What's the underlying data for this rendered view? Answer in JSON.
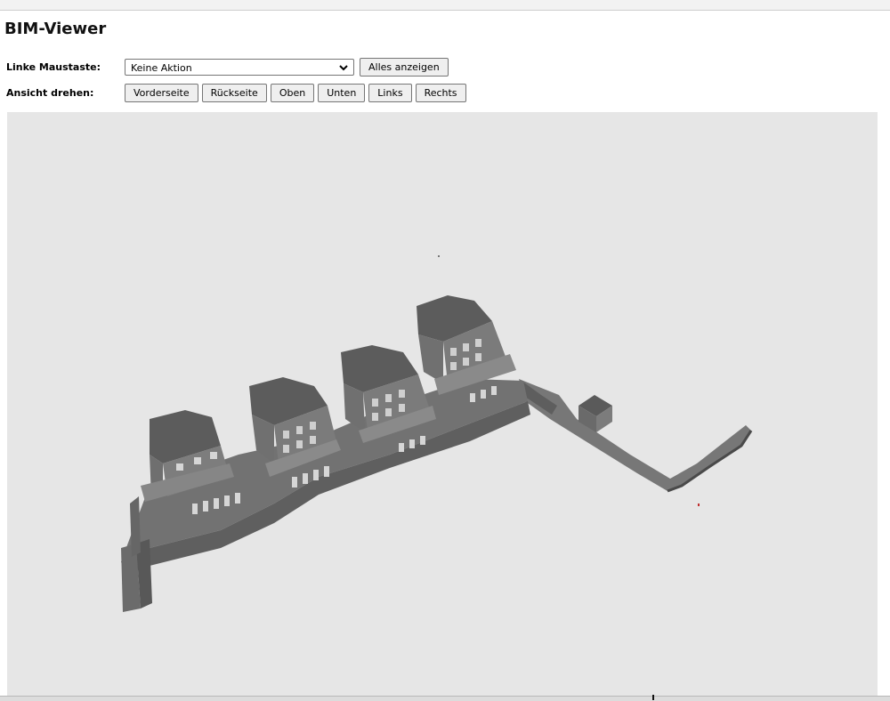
{
  "page": {
    "title": "BIM-Viewer"
  },
  "controls": {
    "left_mouse_label": "Linke Maustaste:",
    "left_mouse_value": "Keine Aktion",
    "show_all_label": "Alles anzeigen",
    "rotate_label": "Ansicht drehen:",
    "rotate_buttons": {
      "front": "Vorderseite",
      "back": "Rückseite",
      "top": "Oben",
      "bottom": "Unten",
      "left": "Links",
      "right": "Rechts"
    }
  },
  "icons": {
    "select_arrow": "chevron-down-icon"
  },
  "colors": {
    "viewport_background": "#e6e6e6",
    "model_main": "#6e6e6e",
    "model_dark": "#555555",
    "model_light": "#8a8a8a",
    "window_color": "#cfcfcf"
  }
}
